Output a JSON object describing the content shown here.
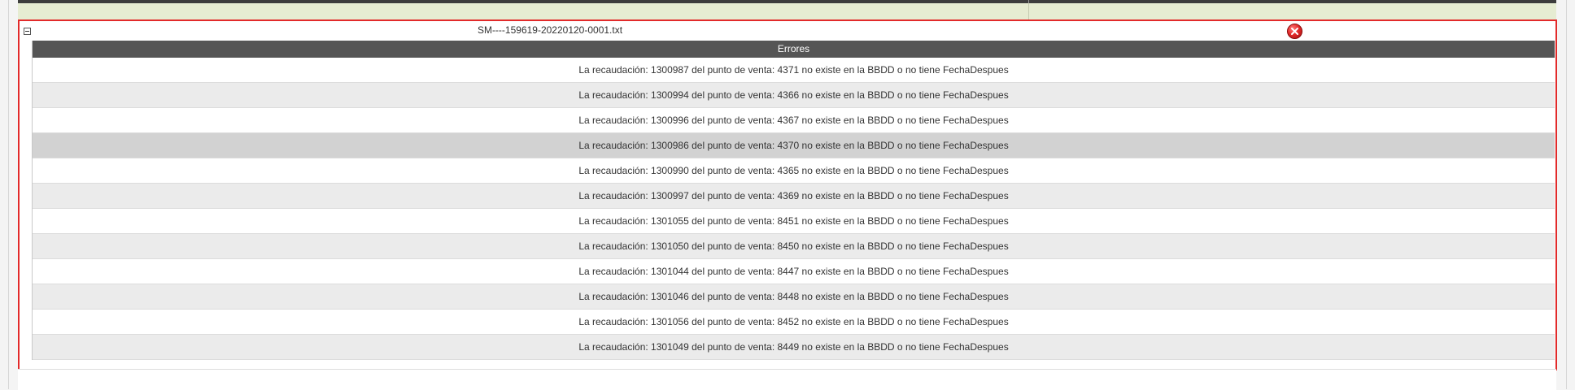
{
  "group": {
    "file_name": "SM----159619-20220120-0001.txt",
    "collapse_icon": "collapse-minus-icon",
    "delete_icon": "red-circle-x-icon"
  },
  "errors": {
    "header": "Errores",
    "rows": [
      "La recaudación: 1300987 del punto de venta: 4371 no existe en la BBDD o no tiene FechaDespues",
      "La recaudación: 1300994 del punto de venta: 4366 no existe en la BBDD o no tiene FechaDespues",
      "La recaudación: 1300996 del punto de venta: 4367 no existe en la BBDD o no tiene FechaDespues",
      "La recaudación: 1300986 del punto de venta: 4370 no existe en la BBDD o no tiene FechaDespues",
      "La recaudación: 1300990 del punto de venta: 4365 no existe en la BBDD o no tiene FechaDespues",
      "La recaudación: 1300997 del punto de venta: 4369 no existe en la BBDD o no tiene FechaDespues",
      "La recaudación: 1301055 del punto de venta: 8451 no existe en la BBDD o no tiene FechaDespues",
      "La recaudación: 1301050 del punto de venta: 8450 no existe en la BBDD o no tiene FechaDespues",
      "La recaudación: 1301044 del punto de venta: 8447 no existe en la BBDD o no tiene FechaDespues",
      "La recaudación: 1301046 del punto de venta: 8448 no existe en la BBDD o no tiene FechaDespues",
      "La recaudación: 1301056 del punto de venta: 8452 no existe en la BBDD o no tiene FechaDespues",
      "La recaudación: 1301049 del punto de venta: 8449 no existe en la BBDD o no tiene FechaDespues"
    ]
  },
  "colors": {
    "group_border": "#e22a2a",
    "header_bg": "#555555",
    "row_alt_bg": "#ebebeb",
    "row_highlight_bg": "#d2d2d2",
    "strip_bg": "#e6ecd2"
  }
}
